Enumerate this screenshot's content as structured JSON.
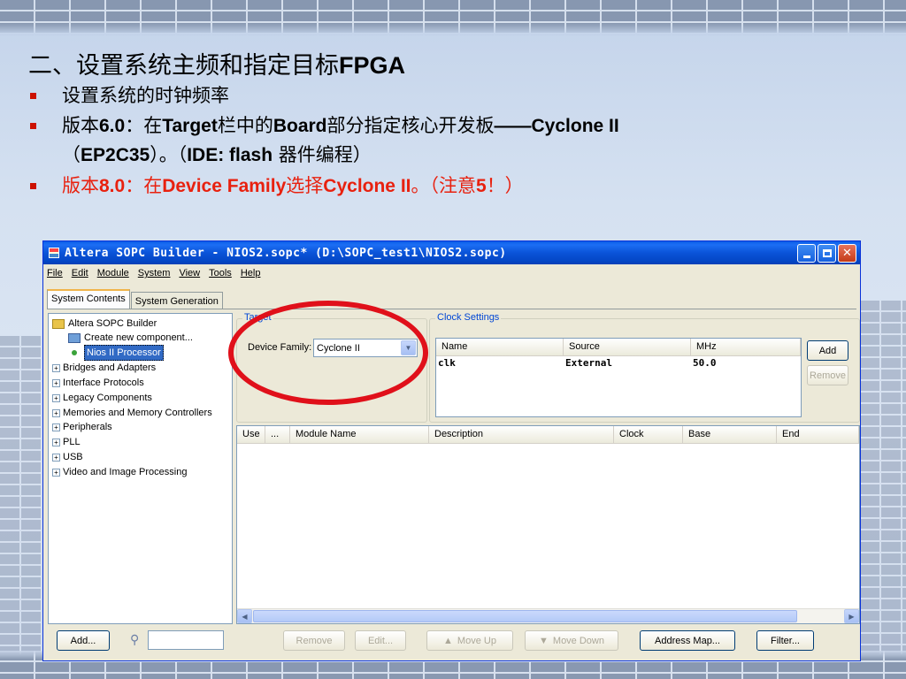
{
  "slide": {
    "title_cn": "二、设置系统主频和指定目标",
    "title_bold": "FPGA",
    "bullet1": "设置系统的时钟频率",
    "bullet2_a": "版本",
    "bullet2_b": "6.0",
    "bullet2_c": "：在",
    "bullet2_d": "Target",
    "bullet2_e": "栏中的",
    "bullet2_f": "Board",
    "bullet2_g": "部分指定核心开发板",
    "bullet2_h": "——Cyclone II",
    "bullet2_line2_a": "（",
    "bullet2_line2_b": "EP2C35",
    "bullet2_line2_c": "）。（",
    "bullet2_line2_d": "IDE: flash",
    "bullet2_line2_e": " 器件编程）",
    "bullet3_a": "版本",
    "bullet3_b": "8.0",
    "bullet3_c": "：在",
    "bullet3_d": "Device Family",
    "bullet3_e": "选择",
    "bullet3_f": "Cyclone II",
    "bullet3_g": "。（注意",
    "bullet3_h": "5",
    "bullet3_i": "！）",
    "accent_color": "#e8210f"
  },
  "window": {
    "title": "Altera SOPC Builder - NIOS2.sopc* (D:\\SOPC_test1\\NIOS2.sopc)",
    "menu": [
      "File",
      "Edit",
      "Module",
      "System",
      "View",
      "Tools",
      "Help"
    ],
    "tabs": [
      "System Contents",
      "System Generation"
    ],
    "tree": {
      "root": "Altera SOPC Builder",
      "create": "Create new component...",
      "selected": "Nios II Processor",
      "categories": [
        "Bridges and Adapters",
        "Interface Protocols",
        "Legacy Components",
        "Memories and Memory Controllers",
        "Peripherals",
        "PLL",
        "USB",
        "Video and Image Processing"
      ]
    },
    "target": {
      "legend": "Target",
      "device_family_label": "Device Family:",
      "device_family_value": "Cyclone II"
    },
    "clock": {
      "legend": "Clock Settings",
      "headers": [
        "Name",
        "Source",
        "MHz"
      ],
      "rows": [
        [
          "clk",
          "External",
          "50.0"
        ]
      ],
      "add": "Add",
      "remove": "Remove"
    },
    "modules": {
      "headers": [
        "Use",
        "...",
        "Module Name",
        "Description",
        "Clock",
        "Base",
        "End"
      ]
    },
    "buttons": {
      "add": "Add...",
      "remove": "Remove",
      "edit": "Edit...",
      "move_up": "Move Up",
      "move_down": "Move Down",
      "address_map": "Address Map...",
      "filter": "Filter..."
    }
  }
}
